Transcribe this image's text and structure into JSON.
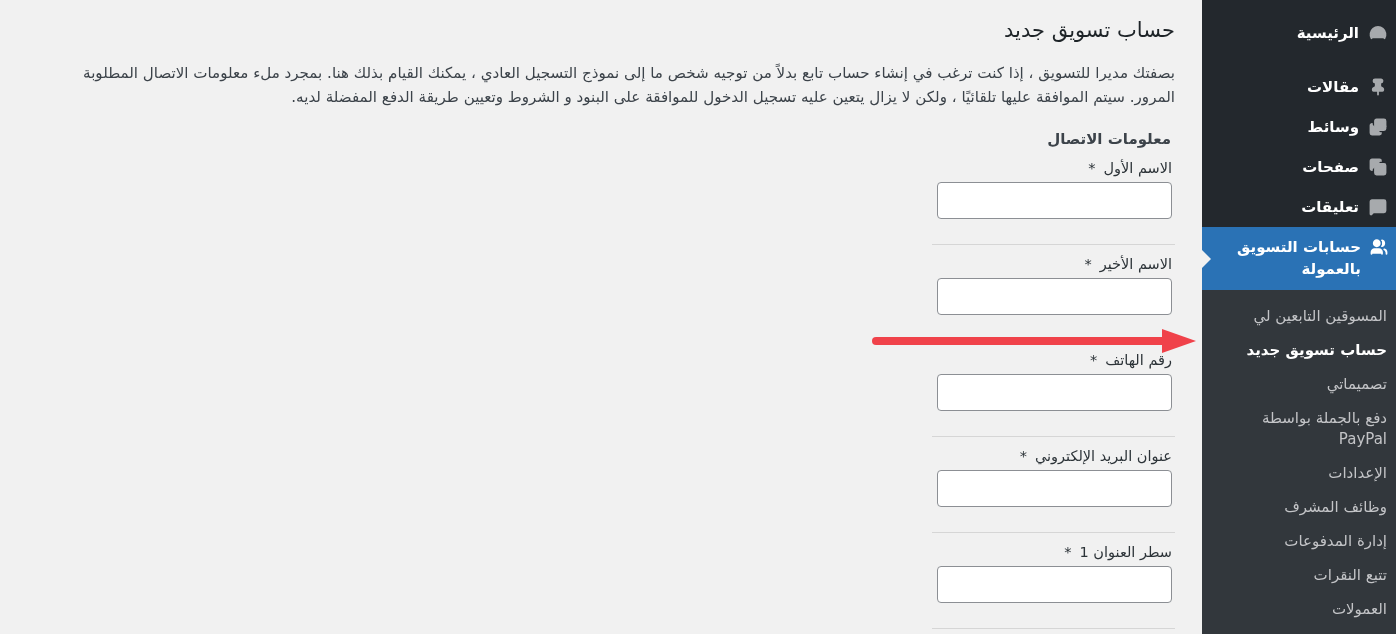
{
  "page": {
    "title": "حساب تسويق جديد",
    "intro_lines": [
      "بصفتك مديرا للتسويق ، إذا كنت ترغب في إنشاء حساب تابع بدلاً من توجيه شخص ما إلى نموذج التسجيل العادي ، يمكنك القيام بذلك هنا. بمجرد ملء معلومات الاتصال المطلوبة",
      "المرور. سيتم الموافقة عليها تلقائيًا ، ولكن لا يزال يتعين عليه تسجيل الدخول للموافقة على البنود و الشروط وتعيين طريقة الدفع المفضلة لديه."
    ]
  },
  "form": {
    "section_title": "معلومات الاتصال",
    "fields": [
      {
        "label": "الاسم الأول",
        "required_mark": "*"
      },
      {
        "label": "الاسم الأخير",
        "required_mark": "*"
      },
      {
        "label": "رقم الهاتف",
        "required_mark": "*"
      },
      {
        "label": "عنوان البريد الإلكتروني",
        "required_mark": "*"
      },
      {
        "label": "سطر العنوان 1",
        "required_mark": "*"
      }
    ]
  },
  "sidebar": {
    "items": [
      {
        "label": "الرئيسية",
        "selected": false
      },
      {
        "label": "مقالات",
        "selected": false
      },
      {
        "label": "وسائط",
        "selected": false
      },
      {
        "label": "صفحات",
        "selected": false
      },
      {
        "label": "تعليقات",
        "selected": false
      },
      {
        "label": "حسابات التسويق بالعمولة",
        "selected": true,
        "children": [
          {
            "label": "المسوقين التابعين لي",
            "selected": false
          },
          {
            "label": "حساب تسويق جديد",
            "selected": true
          },
          {
            "label": "تصميماتي",
            "selected": false
          },
          {
            "label": "دفع بالجملة بواسطة PayPal",
            "selected": false
          },
          {
            "label": "الإعدادات",
            "selected": false
          },
          {
            "label": "وظائف المشرف",
            "selected": false
          },
          {
            "label": "إدارة المدفوعات",
            "selected": false
          },
          {
            "label": "تتبع النقرات",
            "selected": false
          },
          {
            "label": "العمولات",
            "selected": false
          }
        ]
      }
    ]
  }
}
